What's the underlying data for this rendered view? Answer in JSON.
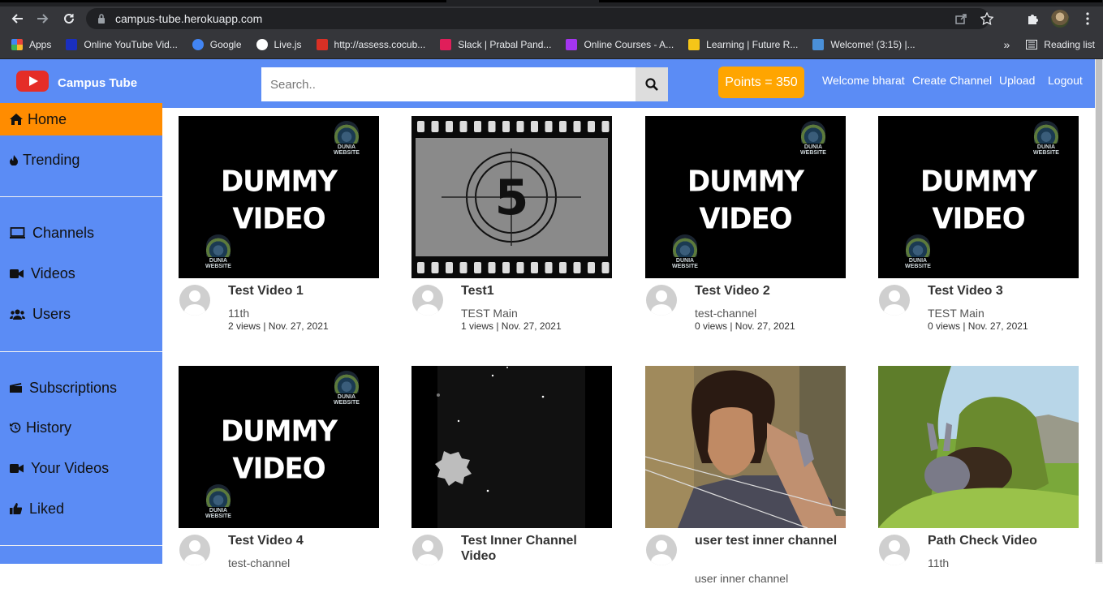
{
  "browser": {
    "url": "campus-tube.herokuapp.com",
    "bookmarks": [
      {
        "label": "Apps",
        "color": "#e8453c"
      },
      {
        "label": "Online YouTube Vid...",
        "color": "#1a2fbf"
      },
      {
        "label": "Google",
        "color": "#4285f4"
      },
      {
        "label": "Live.js",
        "color": "#ffffff"
      },
      {
        "label": "http://assess.cocub...",
        "color": "#d93025"
      },
      {
        "label": "Slack | Prabal Pand...",
        "color": "#e01e5a"
      },
      {
        "label": "Online Courses - A...",
        "color": "#a435f0"
      },
      {
        "label": "Learning | Future R...",
        "color": "#f5c518"
      },
      {
        "label": "Welcome! (3:15) |...",
        "color": "#4a90d9"
      }
    ],
    "reading_list": "Reading list"
  },
  "header": {
    "logo_text": "Campus Tube",
    "search_placeholder": "Search..",
    "points": "Points = 350",
    "links": [
      "Welcome bharat",
      "Create Channel",
      "Upload",
      "Logout"
    ]
  },
  "sidebar": {
    "items": [
      {
        "label": "Home",
        "icon": "home-icon",
        "active": true
      },
      {
        "label": "Trending",
        "icon": "fire-icon"
      },
      {
        "label": "Channels",
        "icon": "monitor-icon"
      },
      {
        "label": "Videos",
        "icon": "video-camera-icon"
      },
      {
        "label": "Users",
        "icon": "users-icon"
      },
      {
        "label": "Subscriptions",
        "icon": "clapperboard-icon"
      },
      {
        "label": "History",
        "icon": "history-icon"
      },
      {
        "label": "Your Videos",
        "icon": "video-camera-icon"
      },
      {
        "label": "Liked",
        "icon": "thumbs-up-icon"
      }
    ]
  },
  "videos": [
    {
      "title": "Test Video 1",
      "channel": "11th",
      "stats": "2 views | Nov. 27, 2021",
      "thumb": "dummy"
    },
    {
      "title": "Test1",
      "channel": "TEST Main",
      "stats": "1 views | Nov. 27, 2021",
      "thumb": "countdown"
    },
    {
      "title": "Test Video 2",
      "channel": "test-channel",
      "stats": "0 views | Nov. 27, 2021",
      "thumb": "dummy"
    },
    {
      "title": "Test Video 3",
      "channel": "TEST Main",
      "stats": "0 views | Nov. 27, 2021",
      "thumb": "dummy"
    },
    {
      "title": "Test Video 4",
      "channel": "test-channel",
      "stats": "",
      "thumb": "dummy"
    },
    {
      "title": "Test Inner Channel Video",
      "channel": "",
      "stats": "",
      "thumb": "space"
    },
    {
      "title": "user test inner channel",
      "channel": "user inner channel",
      "stats": "",
      "thumb": "archer"
    },
    {
      "title": "Path Check Video",
      "channel": "11th",
      "stats": "",
      "thumb": "forest"
    }
  ],
  "thumb_text": {
    "dummy_line1": "DUMMY",
    "dummy_line2": "VIDEO",
    "logo_label": "DUNIA WEBSITE",
    "countdown_number": "5"
  }
}
